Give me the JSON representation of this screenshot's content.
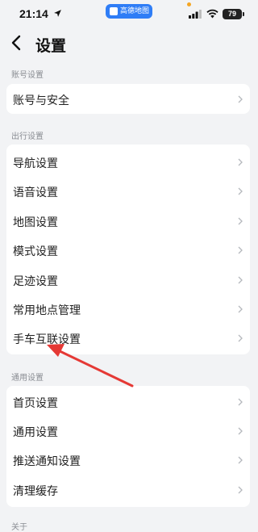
{
  "status_bar": {
    "time": "21:14",
    "app_pill": "高德地图",
    "battery": "79"
  },
  "header": {
    "title": "设置"
  },
  "sections": [
    {
      "label": "账号设置",
      "items": [
        "账号与安全"
      ]
    },
    {
      "label": "出行设置",
      "items": [
        "导航设置",
        "语音设置",
        "地图设置",
        "模式设置",
        "足迹设置",
        "常用地点管理",
        "手车互联设置"
      ]
    },
    {
      "label": "通用设置",
      "items": [
        "首页设置",
        "通用设置",
        "推送通知设置",
        "清理缓存"
      ]
    },
    {
      "label": "关于",
      "items": []
    }
  ],
  "annotation": {
    "color": "#e53935",
    "target_item": "手车互联设置"
  },
  "icons": [
    "location-arrow-icon",
    "signal-icon",
    "wifi-icon",
    "battery-icon",
    "back-chevron-icon",
    "chevron-right-icon"
  ]
}
